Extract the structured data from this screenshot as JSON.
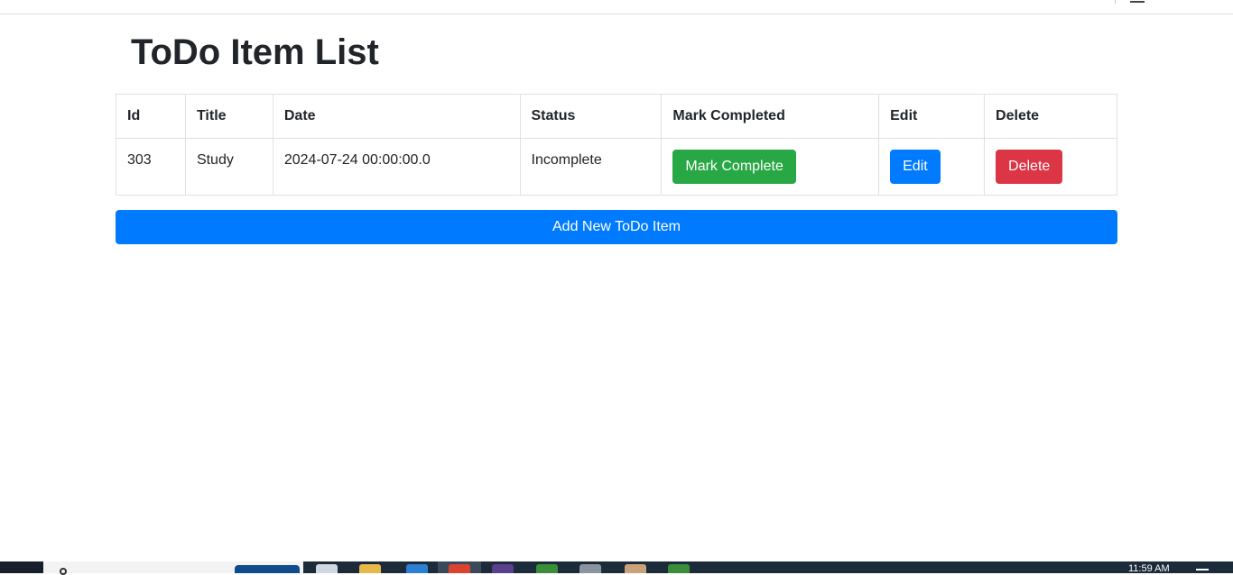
{
  "page": {
    "title": "ToDo Item List"
  },
  "table": {
    "headers": [
      "Id",
      "Title",
      "Date",
      "Status",
      "Mark Completed",
      "Edit",
      "Delete"
    ],
    "rows": [
      {
        "id": "303",
        "title": "Study",
        "date": "2024-07-24 00:00:00.0",
        "status": "Incomplete",
        "mark_label": "Mark Complete",
        "edit_label": "Edit",
        "delete_label": "Delete"
      }
    ]
  },
  "add_button": {
    "label": "Add New ToDo Item"
  },
  "taskbar": {
    "clock": "11:59 AM"
  },
  "colors": {
    "success": "#28a745",
    "primary": "#007bff",
    "danger": "#dc3545",
    "taskbar": "#1c2b3a"
  }
}
